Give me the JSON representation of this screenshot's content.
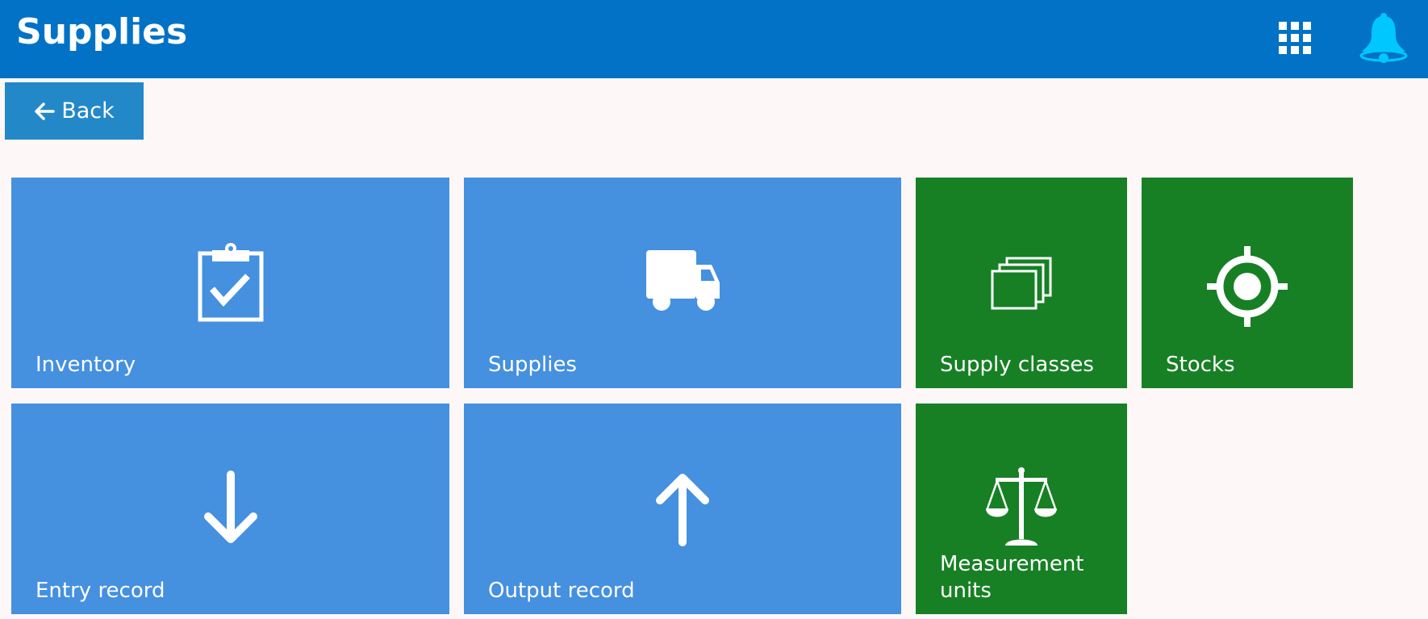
{
  "header": {
    "title": "Supplies",
    "apps_icon": "apps-grid-icon",
    "notification_icon": "bell-icon"
  },
  "back": {
    "label": "Back",
    "icon": "arrow-left-icon"
  },
  "tiles": [
    {
      "label": "Inventory",
      "icon": "clipboard-check-icon",
      "color": "#4590df"
    },
    {
      "label": "Supplies",
      "icon": "truck-icon",
      "color": "#4590df"
    },
    {
      "label": "Supply classes",
      "icon": "stacked-cards-icon",
      "color": "#178024"
    },
    {
      "label": "Stocks",
      "icon": "target-icon",
      "color": "#178024"
    },
    {
      "label": "Entry record",
      "icon": "arrow-down-icon",
      "color": "#4590df"
    },
    {
      "label": "Output record",
      "icon": "arrow-up-icon",
      "color": "#4590df"
    },
    {
      "label": "Measurement units",
      "icon": "scale-icon",
      "color": "#178024"
    }
  ]
}
